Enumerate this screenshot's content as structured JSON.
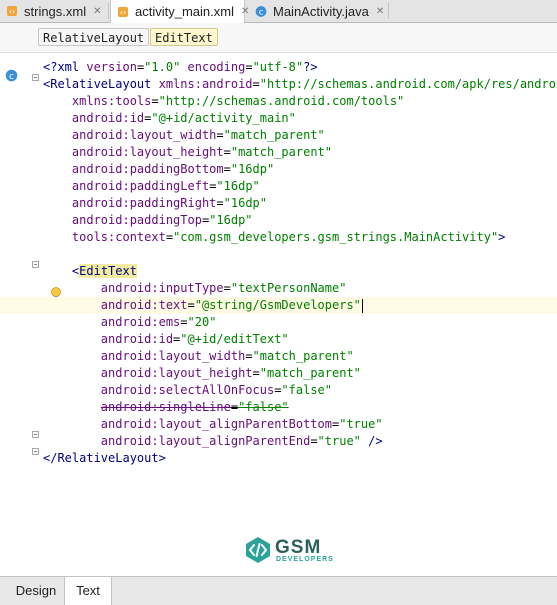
{
  "tabs": [
    {
      "label": "strings.xml",
      "icon": "xml-file-icon",
      "active": false
    },
    {
      "label": "activity_main.xml",
      "icon": "xml-file-icon",
      "active": true
    },
    {
      "label": "MainActivity.java",
      "icon": "java-class-icon",
      "active": false
    }
  ],
  "close_glyph": "✕",
  "breadcrumb": [
    "RelativeLayout",
    "EditText"
  ],
  "code": [
    {
      "parts": [
        [
          "tag",
          "<?"
        ],
        [
          "tag",
          "xml "
        ],
        [
          "attr",
          "version"
        ],
        [
          "eq",
          "="
        ],
        [
          "val",
          "\"1.0\""
        ],
        [
          "plain",
          " "
        ],
        [
          "attr",
          "encoding"
        ],
        [
          "eq",
          "="
        ],
        [
          "val",
          "\"utf-8\""
        ],
        [
          "tag",
          "?>"
        ]
      ]
    },
    {
      "parts": [
        [
          "tag",
          "<RelativeLayout "
        ],
        [
          "attr",
          "xmlns:android"
        ],
        [
          "eq",
          "="
        ],
        [
          "val",
          "\"http://schemas.android.com/apk/res/android\""
        ]
      ]
    },
    {
      "parts": [
        [
          "plain",
          "    "
        ],
        [
          "attr",
          "xmlns:tools"
        ],
        [
          "eq",
          "="
        ],
        [
          "val",
          "\"http://schemas.android.com/tools\""
        ]
      ]
    },
    {
      "parts": [
        [
          "plain",
          "    "
        ],
        [
          "attr",
          "android:id"
        ],
        [
          "eq",
          "="
        ],
        [
          "val",
          "\"@+id/activity_main\""
        ]
      ]
    },
    {
      "parts": [
        [
          "plain",
          "    "
        ],
        [
          "attr",
          "android:layout_width"
        ],
        [
          "eq",
          "="
        ],
        [
          "val",
          "\"match_parent\""
        ]
      ]
    },
    {
      "parts": [
        [
          "plain",
          "    "
        ],
        [
          "attr",
          "android:layout_height"
        ],
        [
          "eq",
          "="
        ],
        [
          "val",
          "\"match_parent\""
        ]
      ]
    },
    {
      "parts": [
        [
          "plain",
          "    "
        ],
        [
          "attr",
          "android:paddingBottom"
        ],
        [
          "eq",
          "="
        ],
        [
          "val",
          "\"16dp\""
        ]
      ]
    },
    {
      "parts": [
        [
          "plain",
          "    "
        ],
        [
          "attr",
          "android:paddingLeft"
        ],
        [
          "eq",
          "="
        ],
        [
          "val",
          "\"16dp\""
        ]
      ]
    },
    {
      "parts": [
        [
          "plain",
          "    "
        ],
        [
          "attr",
          "android:paddingRight"
        ],
        [
          "eq",
          "="
        ],
        [
          "val",
          "\"16dp\""
        ]
      ]
    },
    {
      "parts": [
        [
          "plain",
          "    "
        ],
        [
          "attr",
          "android:paddingTop"
        ],
        [
          "eq",
          "="
        ],
        [
          "val",
          "\"16dp\""
        ]
      ]
    },
    {
      "parts": [
        [
          "plain",
          "    "
        ],
        [
          "attr",
          "tools:context"
        ],
        [
          "eq",
          "="
        ],
        [
          "val",
          "\"com.gsm_developers.gsm_strings.MainActivity\""
        ],
        [
          "tag",
          ">"
        ]
      ]
    },
    {
      "parts": []
    },
    {
      "parts": [
        [
          "plain",
          "    "
        ],
        [
          "tag",
          "<"
        ],
        [
          "tagmatch",
          "EditText"
        ]
      ]
    },
    {
      "parts": [
        [
          "plain",
          "        "
        ],
        [
          "attr",
          "android:inputType"
        ],
        [
          "eq",
          "="
        ],
        [
          "val",
          "\"textPersonName\""
        ]
      ]
    },
    {
      "parts": [
        [
          "plain",
          "        "
        ],
        [
          "attr",
          "android:text"
        ],
        [
          "eq",
          "="
        ],
        [
          "val",
          "\"@string/GsmDevelopers\""
        ],
        [
          "caret",
          ""
        ]
      ],
      "highlight": true
    },
    {
      "parts": [
        [
          "plain",
          "        "
        ],
        [
          "attr",
          "android:ems"
        ],
        [
          "eq",
          "="
        ],
        [
          "val",
          "\"20\""
        ]
      ]
    },
    {
      "parts": [
        [
          "plain",
          "        "
        ],
        [
          "attr",
          "android:id"
        ],
        [
          "eq",
          "="
        ],
        [
          "val",
          "\"@+id/editText\""
        ]
      ]
    },
    {
      "parts": [
        [
          "plain",
          "        "
        ],
        [
          "attr",
          "android:layout_width"
        ],
        [
          "eq",
          "="
        ],
        [
          "val",
          "\"match_parent\""
        ]
      ]
    },
    {
      "parts": [
        [
          "plain",
          "        "
        ],
        [
          "attr",
          "android:layout_height"
        ],
        [
          "eq",
          "="
        ],
        [
          "val",
          "\"match_parent\""
        ]
      ]
    },
    {
      "parts": [
        [
          "plain",
          "        "
        ],
        [
          "attr",
          "android:selectAllOnFocus"
        ],
        [
          "eq",
          "="
        ],
        [
          "val",
          "\"false\""
        ]
      ]
    },
    {
      "parts": [
        [
          "plain",
          "        "
        ],
        [
          "attrstrike",
          "android:singleLine"
        ],
        [
          "eqstrike",
          "="
        ],
        [
          "valstrike",
          "\"false\""
        ]
      ]
    },
    {
      "parts": [
        [
          "plain",
          "        "
        ],
        [
          "attr",
          "android:layout_alignParentBottom"
        ],
        [
          "eq",
          "="
        ],
        [
          "val",
          "\"true\""
        ]
      ]
    },
    {
      "parts": [
        [
          "plain",
          "        "
        ],
        [
          "attr",
          "android:layout_alignParentEnd"
        ],
        [
          "eq",
          "="
        ],
        [
          "val",
          "\"true\""
        ],
        [
          "plain",
          " "
        ],
        [
          "tag",
          "/>"
        ]
      ]
    },
    {
      "parts": [
        [
          "tag",
          "</RelativeLayout>"
        ]
      ]
    }
  ],
  "logo": {
    "name": "GSM",
    "sub": "DEVELOPERS"
  },
  "bottom_tabs": [
    {
      "label": "Design",
      "active": false
    },
    {
      "label": "Text",
      "active": true
    }
  ],
  "colors": {
    "tag": "#000080",
    "attr": "#660e7a",
    "value": "#008000",
    "highlight_line": "#fffae3"
  }
}
